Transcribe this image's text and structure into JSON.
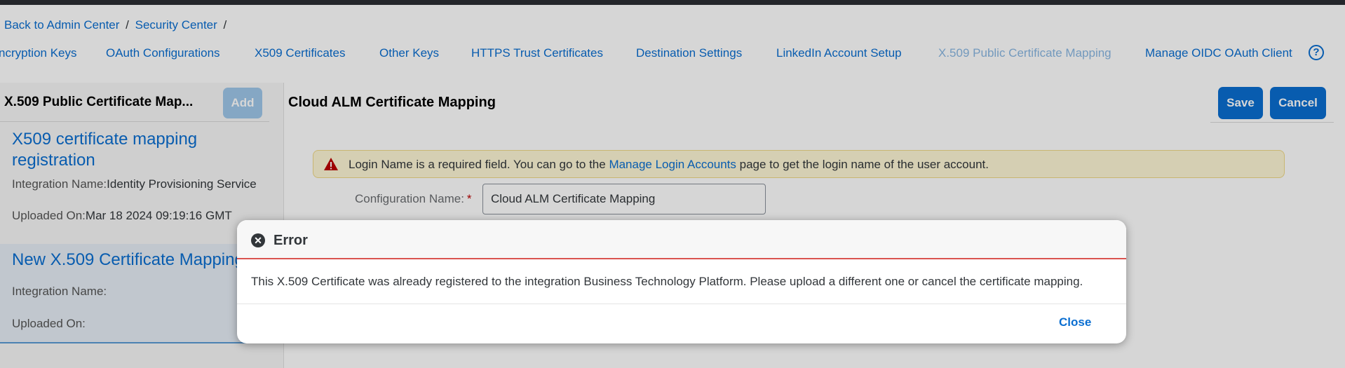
{
  "breadcrumb": {
    "items": [
      "Back to Admin Center",
      "Security Center"
    ],
    "separator": "/"
  },
  "tabs": [
    {
      "label": "ncryption Keys",
      "active": false
    },
    {
      "label": "OAuth Configurations",
      "active": false
    },
    {
      "label": "X509 Certificates",
      "active": false
    },
    {
      "label": "Other Keys",
      "active": false
    },
    {
      "label": "HTTPS Trust Certificates",
      "active": false
    },
    {
      "label": "Destination Settings",
      "active": false
    },
    {
      "label": "LinkedIn Account Setup",
      "active": false
    },
    {
      "label": "X.509 Public Certificate Mapping",
      "active": true
    },
    {
      "label": "Manage OIDC OAuth Client",
      "active": false
    }
  ],
  "help_icon": "?",
  "master": {
    "title": "X.509 Public Certificate Map...",
    "add_label": "Add",
    "items": [
      {
        "title": "X509 certificate mapping registration",
        "integration_label": "Integration Name:",
        "integration_value": "Identity Provisioning Service",
        "uploaded_label": "Uploaded On:",
        "uploaded_value": "Mar 18 2024 09:19:16 GMT"
      },
      {
        "title": "New X.509 Certificate Mapping",
        "integration_label": "Integration Name:",
        "integration_value": "",
        "uploaded_label": "Uploaded On:",
        "uploaded_value": ""
      }
    ]
  },
  "detail": {
    "title": "Cloud ALM Certificate Mapping",
    "save_label": "Save",
    "cancel_label": "Cancel",
    "warning": {
      "text_before": "Login Name is a required field. You can go to the",
      "link": "Manage Login Accounts",
      "text_after": "page to get the login name of the user account."
    },
    "config_label": "Configuration Name:",
    "required_mark": "*",
    "config_value": "Cloud ALM Certificate Mapping"
  },
  "dialog": {
    "title": "Error",
    "message": "This X.509 Certificate was already registered to the integration Business Technology Platform. Please upload a different one or cancel the certificate mapping.",
    "close_label": "Close"
  },
  "colors": {
    "accent": "#0a6ed1",
    "active_tab": "#89b7e2",
    "warning_bg": "#fef7d6",
    "error_line": "#d9534f"
  }
}
